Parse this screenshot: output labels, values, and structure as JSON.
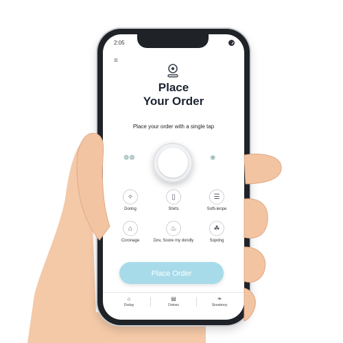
{
  "status_bar": {
    "time": "2:05"
  },
  "header": {
    "menu_icon": "menu-icon",
    "logo_icon": "location-pin-icon"
  },
  "title": {
    "line1": "Place",
    "line2": "Your Order"
  },
  "subtitle": "Place your order with a single tap",
  "side_icons": {
    "left": "❁❁",
    "right": "❀"
  },
  "categories": [
    {
      "label": "Doring",
      "icon": "shirt-icon",
      "glyph": "✧"
    },
    {
      "label": "Shirts",
      "icon": "bottle-icon",
      "glyph": "▯"
    },
    {
      "label": "Softi-lenpe",
      "icon": "clipboard-icon",
      "glyph": "☰"
    },
    {
      "label": "Coronage",
      "icon": "home-icon",
      "glyph": "⌂"
    },
    {
      "label": "Dov, Soore my dondly",
      "icon": "basket-icon",
      "glyph": "♨"
    },
    {
      "label": "Sopdng",
      "icon": "leaf-icon",
      "glyph": "☘"
    }
  ],
  "primary_button": {
    "label": "Place Order",
    "color": "#a8dbe9"
  },
  "tabs": [
    {
      "label": "Doday",
      "icon": "home-tab-icon",
      "glyph": "⌂"
    },
    {
      "label": "Dotnes",
      "icon": "calendar-tab-icon",
      "glyph": "▤"
    },
    {
      "label": "Sireatmoy",
      "icon": "tag-tab-icon",
      "glyph": "❧"
    }
  ]
}
